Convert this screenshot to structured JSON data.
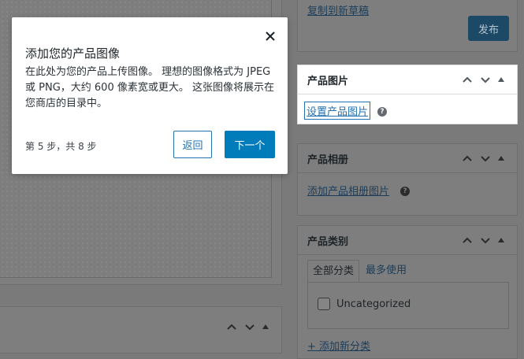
{
  "popup": {
    "title": "添加您的产品图像",
    "body": "在此处为您的产品上传图像。 理想的图像格式为 JPEG 或 PNG，大约 600 像素宽或更大。 这张图像将展示在您商店的目录中。",
    "step": "第 5 步，共 8 步",
    "back_label": "返回",
    "next_label": "下一个"
  },
  "publish": {
    "copy_draft_label": "复制到新草稿",
    "publish_label": "发布"
  },
  "product_image": {
    "title": "产品图片",
    "set_image_label": "设置产品图片",
    "help": "?"
  },
  "product_gallery": {
    "title": "产品相册",
    "add_gallery_label": "添加产品相册图片",
    "help": "?"
  },
  "product_categories": {
    "title": "产品类别",
    "tabs": [
      "全部分类",
      "最多使用"
    ],
    "items": [
      {
        "label": "Uncategorized",
        "checked": false
      }
    ],
    "add_label": "+ 添加新分类"
  },
  "colors": {
    "primary": "#007cba",
    "link": "#2271b1",
    "overlay": "#7a7a7a"
  }
}
